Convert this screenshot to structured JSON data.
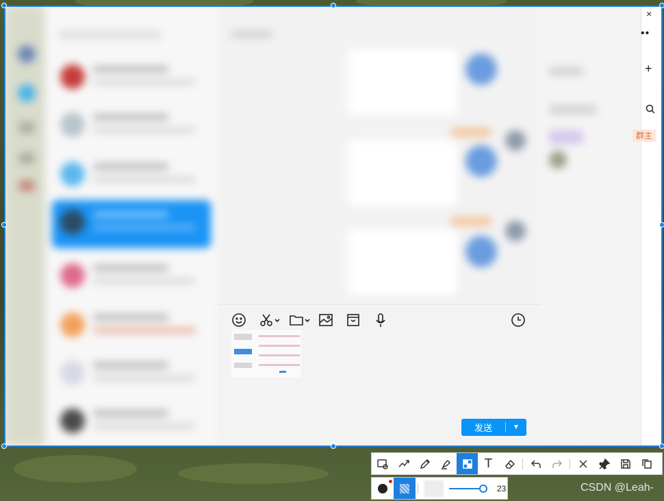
{
  "composer": {
    "send_label": "发送",
    "tools": [
      "emoji-icon",
      "scissors-icon",
      "folder-icon",
      "image-icon",
      "box-icon",
      "microphone-icon",
      "clock-icon"
    ]
  },
  "side_panel": {
    "tag_label": "群主",
    "close_glyph": "×",
    "more_glyph": "••",
    "plus_glyph": "+"
  },
  "screenshot_toolbar": {
    "tools": [
      {
        "name": "shape-tool",
        "icon": "shape-icon",
        "active": false
      },
      {
        "name": "polyline-tool",
        "icon": "polyline-icon",
        "active": false
      },
      {
        "name": "pen-tool",
        "icon": "pen-icon",
        "active": false
      },
      {
        "name": "highlighter-tool",
        "icon": "highlighter-icon",
        "active": false
      },
      {
        "name": "mosaic-tool",
        "icon": "mosaic-icon",
        "active": true
      },
      {
        "name": "text-tool",
        "icon": "text-icon",
        "active": false
      },
      {
        "name": "eraser-tool",
        "icon": "eraser-icon",
        "active": false
      },
      {
        "name": "undo",
        "icon": "undo-icon",
        "active": false
      },
      {
        "name": "redo",
        "icon": "redo-icon",
        "active": false
      },
      {
        "name": "cancel",
        "icon": "close-icon",
        "active": false
      },
      {
        "name": "pin",
        "icon": "pin-icon",
        "active": false
      },
      {
        "name": "save",
        "icon": "save-icon",
        "active": false
      },
      {
        "name": "copy",
        "icon": "copy-icon",
        "active": false
      }
    ],
    "brush_size": 23,
    "brush_size_fraction": 1.0,
    "text_glyph": "T"
  },
  "colors": {
    "accent": "#1e7fde",
    "send_button": "#0a94f7",
    "active_row": "#1a93f5",
    "color_dot_indicator": "#e01e1e"
  },
  "watermark": "CSDN @Leah-"
}
